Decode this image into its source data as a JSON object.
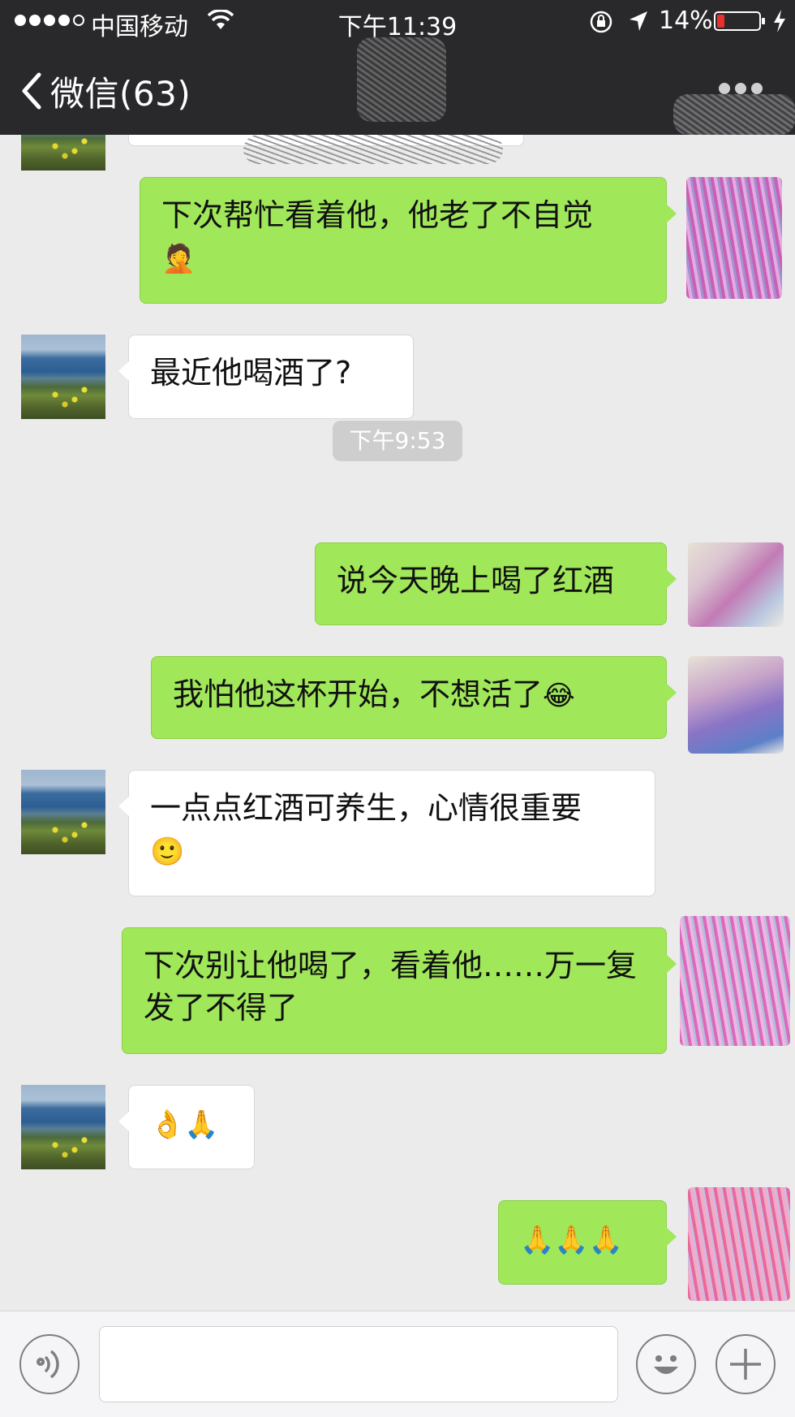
{
  "status_bar": {
    "carrier": "中国移动",
    "time": "下午11:39",
    "battery": "14%",
    "signal_bars_filled": 4,
    "signal_bars_total": 5
  },
  "nav": {
    "back_label": "微信(63)",
    "more_icon": "more-dots-icon"
  },
  "messages": [
    {
      "side": "sent",
      "text": "下次帮忙看着他，他老了不自觉",
      "emoji": "🤦"
    },
    {
      "side": "received",
      "text": "最近他喝酒了?"
    },
    {
      "timestamp": "下午9:53"
    },
    {
      "side": "sent",
      "text": "说今天晚上喝了红酒"
    },
    {
      "side": "sent",
      "text": "我怕他这杯开始，不想活了",
      "emoji": "😂"
    },
    {
      "side": "received",
      "text": "一点点红酒可养生，心情很重要",
      "emoji": "🙂"
    },
    {
      "side": "sent",
      "text": "下次别让他喝了，看着他……万一复发了不得了"
    },
    {
      "side": "received",
      "text": "👌🙏"
    },
    {
      "side": "sent",
      "text": "🙏🙏🙏"
    }
  ],
  "input_bar": {
    "voice_icon": "voice-icon",
    "emoji_icon": "smiley-icon",
    "plus_icon": "plus-icon",
    "placeholder": ""
  },
  "colors": {
    "header_bg": "#29292c",
    "chat_bg": "#ebebeb",
    "sent_bubble": "#a0e75a",
    "received_bubble": "#ffffff",
    "battery_low": "#e8302c"
  }
}
